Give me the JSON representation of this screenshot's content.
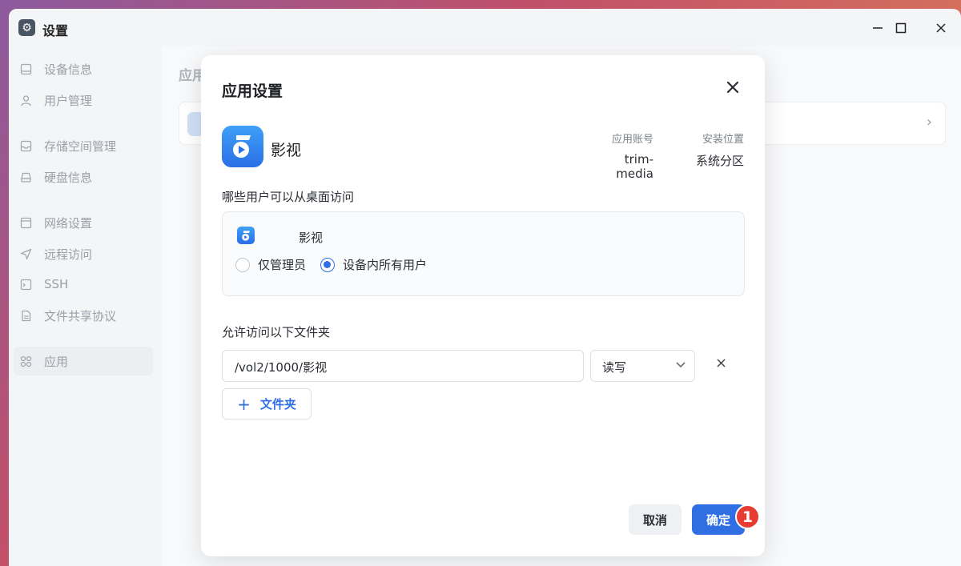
{
  "window": {
    "title": "设置"
  },
  "sidebar": {
    "items": [
      {
        "label": "设备信息",
        "icon": "device-icon"
      },
      {
        "label": "用户管理",
        "icon": "user-icon"
      },
      {
        "label": "存储空间管理",
        "icon": "storage-icon"
      },
      {
        "label": "硬盘信息",
        "icon": "disk-icon"
      },
      {
        "label": "网络设置",
        "icon": "network-icon"
      },
      {
        "label": "远程访问",
        "icon": "remote-icon"
      },
      {
        "label": "SSH",
        "icon": "ssh-icon"
      },
      {
        "label": "文件共享协议",
        "icon": "file-share-icon"
      },
      {
        "label": "应用",
        "icon": "apps-icon",
        "active": true
      }
    ]
  },
  "content": {
    "title": "应用"
  },
  "modal": {
    "title": "应用设置",
    "app_name": "影视",
    "account_label": "应用账号",
    "account_value": "trim-media",
    "location_label": "安装位置",
    "location_value": "系统分区",
    "access_label": "哪些用户可以从桌面访问",
    "perm_app_name": "影视",
    "radio_admin": "仅管理员",
    "radio_all": "设备内所有用户",
    "selected_radio": "radio_all",
    "folders_label": "允许访问以下文件夹",
    "folder_path": "/vol2/1000/影视",
    "folder_permission": "读写",
    "add_folder_label": "文件夹",
    "cancel_label": "取消",
    "ok_label": "确定",
    "badge_number": "1"
  },
  "colors": {
    "accent": "#2f6fe3",
    "badge": "#e63c32"
  }
}
